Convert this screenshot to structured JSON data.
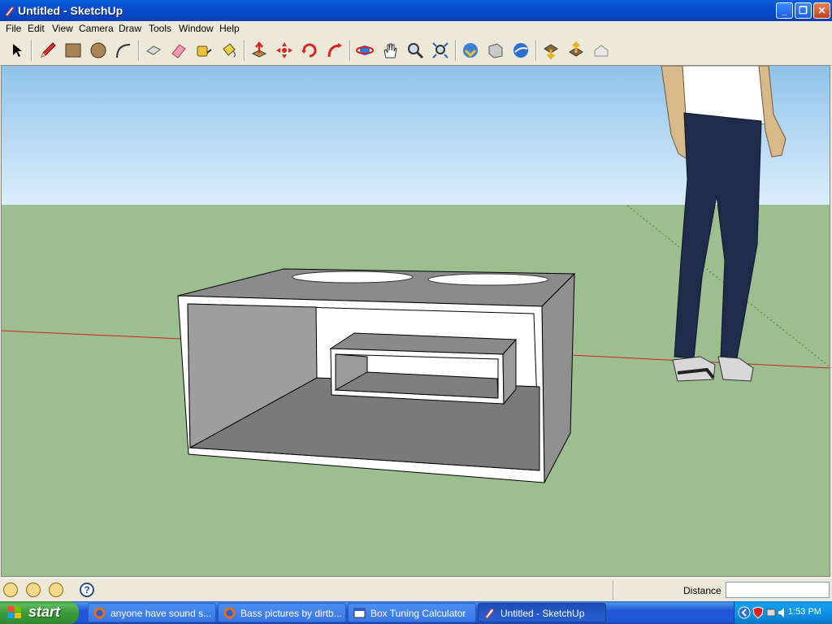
{
  "window": {
    "title": "Untitled - SketchUp"
  },
  "menu": [
    "File",
    "Edit",
    "View",
    "Camera",
    "Draw",
    "Tools",
    "Window",
    "Help"
  ],
  "toolbar": {
    "tools": [
      "select-tool",
      "pencil-tool",
      "rectangle-tool",
      "circle-tool",
      "arc-tool",
      "make-component-tool",
      "eraser-tool",
      "tape-measure-tool",
      "paint-bucket-tool",
      "push-pull-tool",
      "move-tool",
      "rotate-tool",
      "follow-me-tool",
      "orbit-tool",
      "pan-tool",
      "zoom-tool",
      "zoom-extents-tool",
      "get-models-tool",
      "share-model-tool",
      "google-earth-tool",
      "get-current-view-tool",
      "toggle-terrain-tool",
      "place-model-tool"
    ]
  },
  "statusbar": {
    "measurements_label": "Distance",
    "measurements_value": ""
  },
  "taskbar": {
    "start_label": "start",
    "tasks": [
      {
        "label": "anyone have sound s...",
        "icon": "firefox-icon"
      },
      {
        "label": "Bass pictures by dirtb...",
        "icon": "firefox-icon"
      },
      {
        "label": "Box Tuning Calculator",
        "icon": "app-window-icon"
      },
      {
        "label": "Untitled - SketchUp",
        "icon": "sketchup-icon",
        "active": true
      }
    ],
    "clock": "1:53 PM"
  },
  "colors": {
    "sky_top": "#8fc3ea",
    "sky_bottom": "#dceefa",
    "ground": "#9dbe8f",
    "box_face": "#808080",
    "red_axis": "#cc2222",
    "green_axis": "#3c8a3c"
  }
}
